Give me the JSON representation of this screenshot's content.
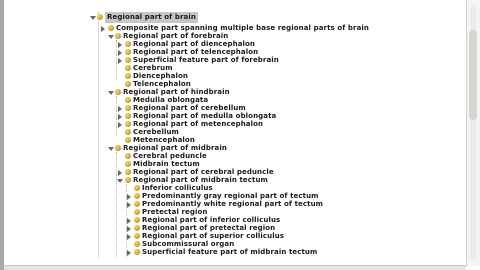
{
  "tree": {
    "rows": [
      {
        "label": "Regional part of brain",
        "selected": true
      },
      {
        "label": "Composite part spanning multiple base regional parts of brain"
      },
      {
        "label": "Regional part of forebrain"
      },
      {
        "label": "Regional part of diencephalon"
      },
      {
        "label": "Regional part of telencephalon"
      },
      {
        "label": "Superficial feature part of forebrain"
      },
      {
        "label": "Cerebrum"
      },
      {
        "label": "Diencephalon"
      },
      {
        "label": "Telencephalon"
      },
      {
        "label": "Regional part of hindbrain"
      },
      {
        "label": "Medulla oblongata"
      },
      {
        "label": "Regional part of cerebellum"
      },
      {
        "label": "Regional part of medulla oblongata"
      },
      {
        "label": "Regional part of metencephalon"
      },
      {
        "label": "Cerebellum"
      },
      {
        "label": "Metencephalon"
      },
      {
        "label": "Regional part of midbrain"
      },
      {
        "label": "Cerebral peduncle"
      },
      {
        "label": "Midbrain tectum"
      },
      {
        "label": "Regional part of cerebral peduncle"
      },
      {
        "label": "Regional part of midbrain tectum"
      },
      {
        "label": "Inferior colliculus"
      },
      {
        "label": "Predominantly gray regional part of tectum"
      },
      {
        "label": "Predominantly white regional part of tectum"
      },
      {
        "label": "Pretectal region"
      },
      {
        "label": "Regional part of inferior colliculus"
      },
      {
        "label": "Regional part of pretectal region"
      },
      {
        "label": "Regional part of superior colliculus"
      },
      {
        "label": "Subcommissural organ"
      },
      {
        "label": "Superficial feature part of midbrain tectum"
      }
    ]
  }
}
